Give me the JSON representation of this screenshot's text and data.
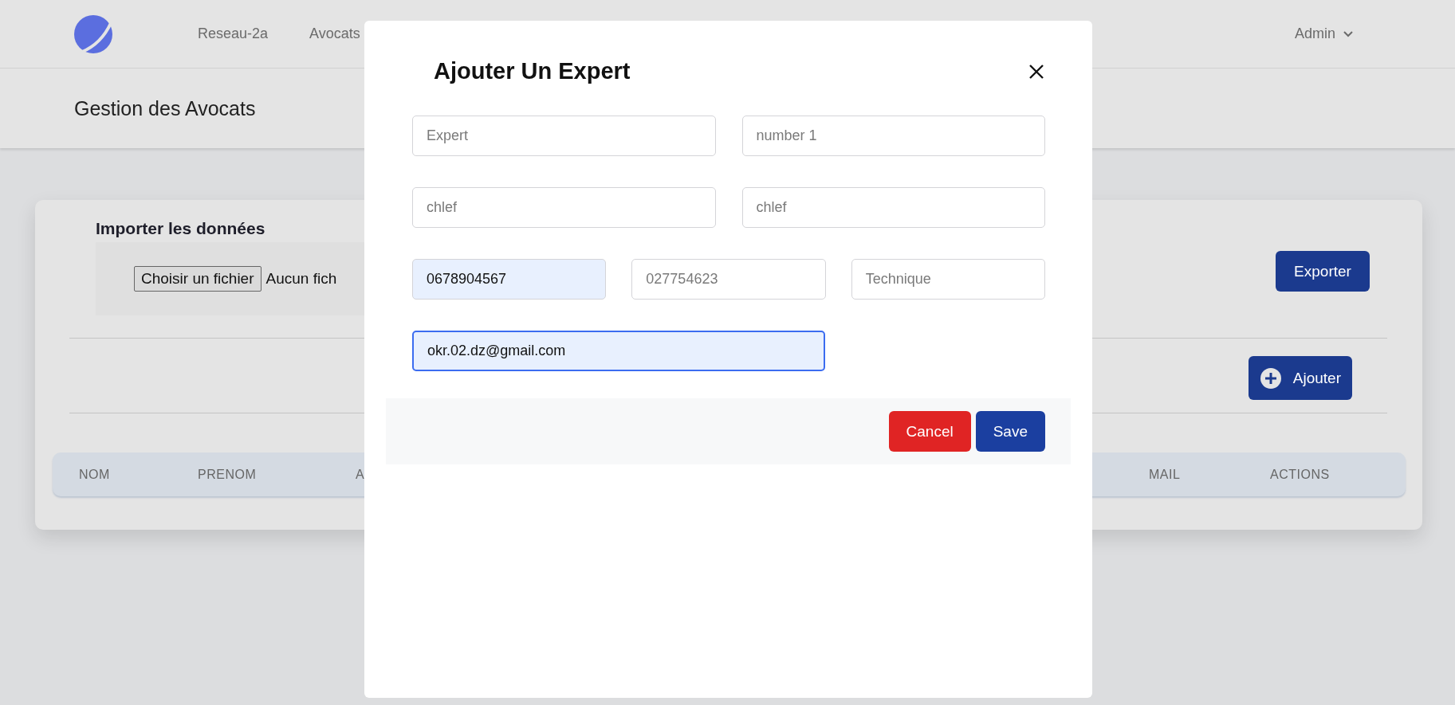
{
  "navbar": {
    "links": [
      {
        "label": "Reseau-2a"
      },
      {
        "label": "Avocats"
      }
    ],
    "user_menu": "Admin"
  },
  "page_title": "Gestion des Avocats",
  "import": {
    "title": "Importer les données",
    "file_button": "Choisir un fichier",
    "file_status": "Aucun fich"
  },
  "export_button": "Exporter",
  "add_button": "Ajouter",
  "table": {
    "columns": [
      "NOM",
      "PRENOM",
      "A",
      "MAIL",
      "ACTIONS"
    ]
  },
  "modal": {
    "title": "Ajouter Un Expert",
    "field_rows": [
      [
        {
          "placeholder": "Expert",
          "focused": false,
          "autofilled": false
        },
        {
          "placeholder": "number 1",
          "focused": false,
          "autofilled": false
        }
      ],
      [
        {
          "placeholder": "chlef",
          "focused": false,
          "autofilled": false
        },
        {
          "placeholder": "chlef",
          "focused": false,
          "autofilled": false
        }
      ],
      [
        {
          "value": "0678904567",
          "focused": false,
          "autofilled": true
        },
        {
          "placeholder": "027754623",
          "focused": false,
          "autofilled": false
        },
        {
          "placeholder": "Technique",
          "focused": false,
          "autofilled": false
        }
      ],
      [
        {
          "value": "okr.02.dz@gmail.com",
          "focused": true,
          "autofilled": true
        }
      ]
    ],
    "buttons": [
      {
        "label": "Cancel",
        "kind": "danger"
      },
      {
        "label": "Save",
        "kind": "primary"
      }
    ]
  }
}
